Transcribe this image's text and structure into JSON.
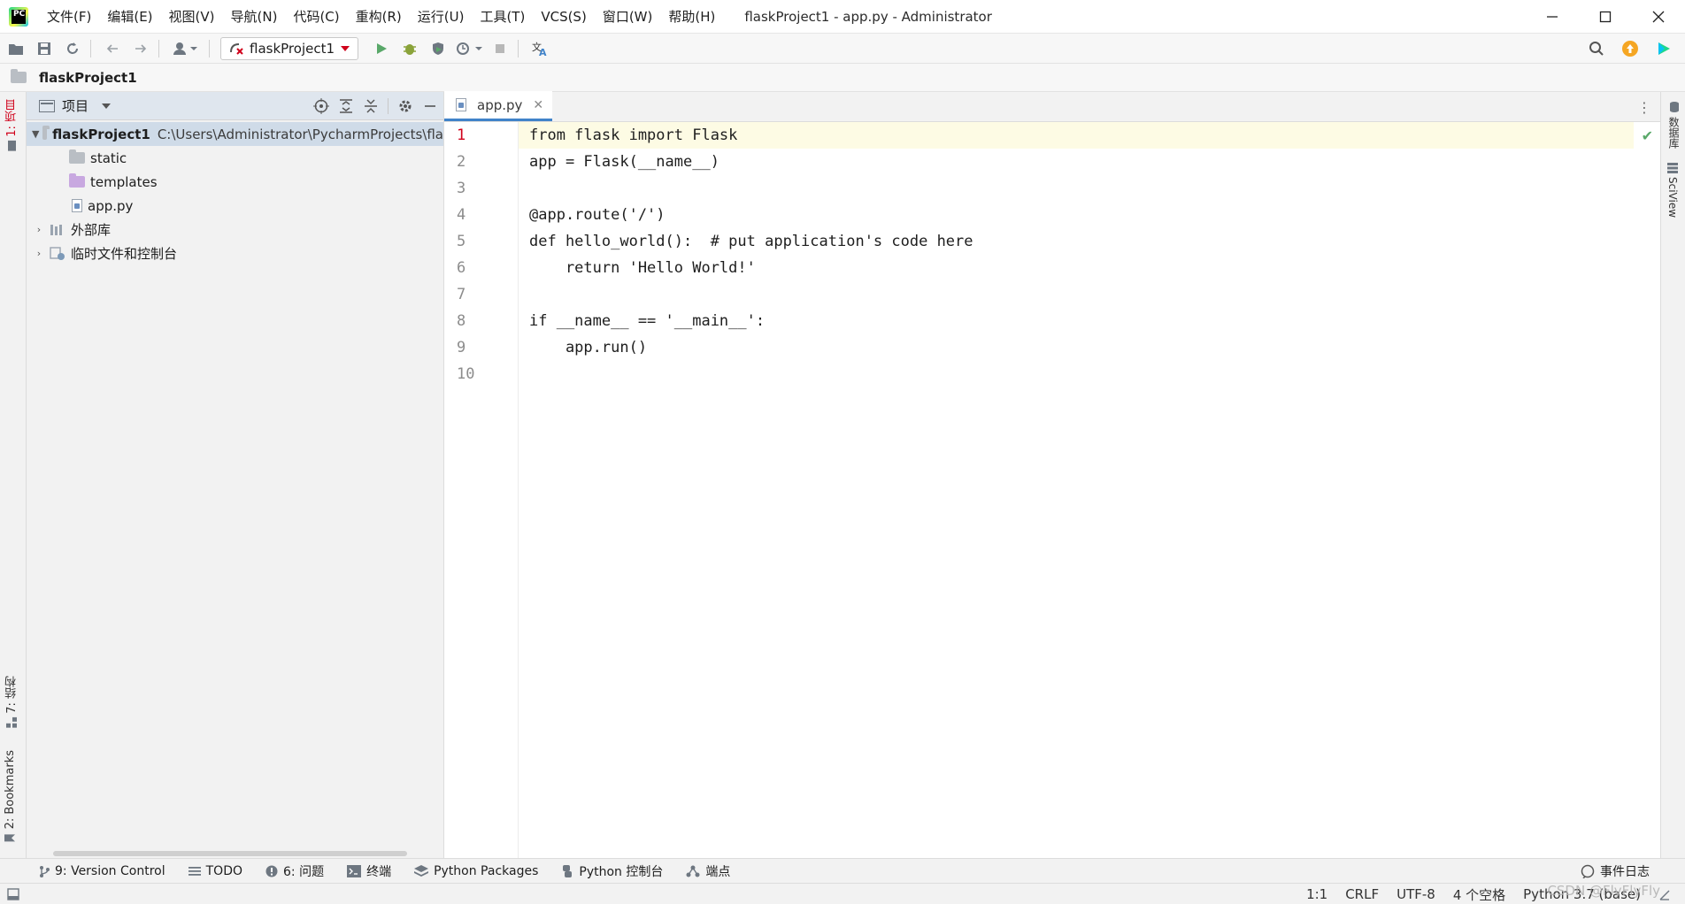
{
  "menu": {
    "items": [
      "文件(F)",
      "编辑(E)",
      "视图(V)",
      "导航(N)",
      "代码(C)",
      "重构(R)",
      "运行(U)",
      "工具(T)",
      "VCS(S)",
      "窗口(W)",
      "帮助(H)"
    ],
    "window_title": "flaskProject1 - app.py - Administrator"
  },
  "toolbar": {
    "run_config": "flaskProject1"
  },
  "navbar": {
    "project": "flaskProject1"
  },
  "left_stripe": {
    "project_tab": "1: 项目",
    "structure_tab": "7: 结构",
    "bookmarks_tab": "2: Bookmarks"
  },
  "project_panel": {
    "title": "项目",
    "root_name": "flaskProject1",
    "root_path": "C:\\Users\\Administrator\\PycharmProjects\\fla",
    "items": [
      {
        "label": "static"
      },
      {
        "label": "templates"
      },
      {
        "label": "app.py"
      }
    ],
    "external_libs": "外部库",
    "scratches": "临时文件和控制台"
  },
  "editor": {
    "tab_label": "app.py",
    "line_numbers": [
      "1",
      "2",
      "3",
      "4",
      "5",
      "6",
      "7",
      "8",
      "9",
      "10"
    ],
    "lines": [
      "from flask import Flask",
      "app = Flask(__name__)",
      "",
      "@app.route('/')",
      "def hello_world():  # put application's code here",
      "    return 'Hello World!'",
      "",
      "if __name__ == '__main__':",
      "    app.run()",
      ""
    ]
  },
  "right_stripe": {
    "database_tab": "数据库",
    "sciview_tab": "SciView"
  },
  "bottom_bar": {
    "version_control": "9: Version Control",
    "todo": "TODO",
    "problems": "6: 问题",
    "terminal": "终端",
    "python_packages": "Python Packages",
    "python_console": "Python 控制台",
    "endpoints": "端点",
    "event_log": "事件日志"
  },
  "status_bar": {
    "position": "1:1",
    "line_sep": "CRLF",
    "encoding": "UTF-8",
    "indent": "4 个空格",
    "interpreter": "Python 3.7 (base)",
    "watermark": "CSDN @FlyFlyFly"
  },
  "colors": {
    "accent": "#4083c9",
    "run_green": "#59a869",
    "current_line": "#fdfbe4",
    "error_red": "#d0021b"
  }
}
